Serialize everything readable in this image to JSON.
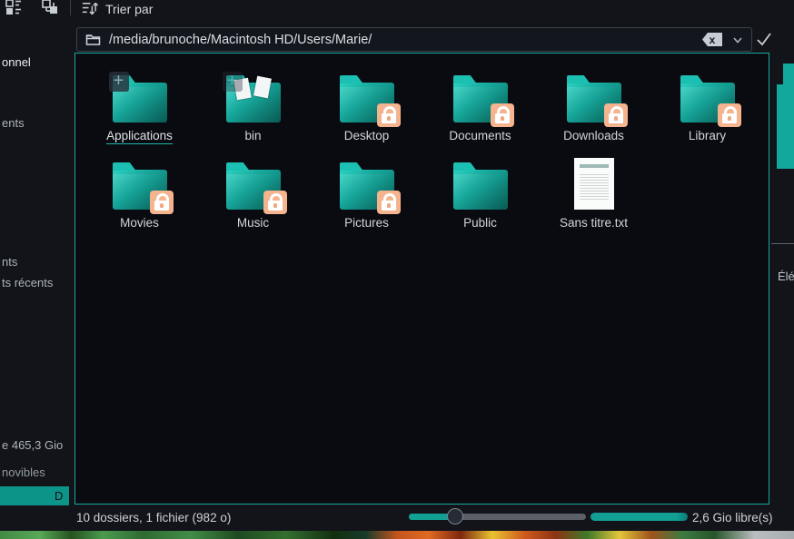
{
  "colors": {
    "accent_teal": "#12a095",
    "view_border": "#18a89d",
    "folder_gradient_start": "#2bd2c2",
    "folder_gradient_end": "#0b6f66",
    "lock_emblem": "#f5b38e",
    "selection_background": "#0d9488",
    "window_background": "#12141a",
    "view_background": "#0a0b10"
  },
  "toolbar": {
    "sort_label": "Trier par",
    "icons": [
      "view-details-icon",
      "view-split-icon",
      "sort-icon"
    ]
  },
  "location_bar": {
    "path": "/media/brunoche/Macintosh HD/Users/Marie/",
    "clear_glyph": "x",
    "icons": [
      "folder-icon",
      "clear-backspace-icon",
      "chevron-down-icon",
      "accept-check-icon"
    ]
  },
  "sidebar": {
    "note": "places panel cut off at screenshot left edge; only label endings visible",
    "fragments": [
      {
        "text": "onnel"
      },
      {
        "text": "ents"
      },
      {
        "text": "nts"
      },
      {
        "text": "ts récents"
      },
      {
        "text": "e 465,3 Gio"
      },
      {
        "text": "novibles"
      }
    ],
    "selected_fragment": "D"
  },
  "files": [
    {
      "name": "Applications",
      "type": "folder",
      "locked": false,
      "hovered": true,
      "select_plus_overlay": true
    },
    {
      "name": "bin",
      "type": "folder",
      "locked": false,
      "papers": true,
      "select_plus_overlay": true
    },
    {
      "name": "Desktop",
      "type": "folder",
      "locked": true
    },
    {
      "name": "Documents",
      "type": "folder",
      "locked": true
    },
    {
      "name": "Downloads",
      "type": "folder",
      "locked": true
    },
    {
      "name": "Library",
      "type": "folder",
      "locked": true
    },
    {
      "name": "Movies",
      "type": "folder",
      "locked": true
    },
    {
      "name": "Music",
      "type": "folder",
      "locked": true
    },
    {
      "name": "Pictures",
      "type": "folder",
      "locked": true
    },
    {
      "name": "Public",
      "type": "folder",
      "locked": false
    },
    {
      "name": "Sans titre.txt",
      "type": "text-file",
      "locked": false
    }
  ],
  "status_bar": {
    "summary": "10 dossiers, 1 fichier (982 o)",
    "free_space": "2,6 Gio libre(s)",
    "zoom_slider_percent": 26,
    "capacity_percent": 100
  },
  "right_panel": {
    "fragment": "Élé"
  }
}
